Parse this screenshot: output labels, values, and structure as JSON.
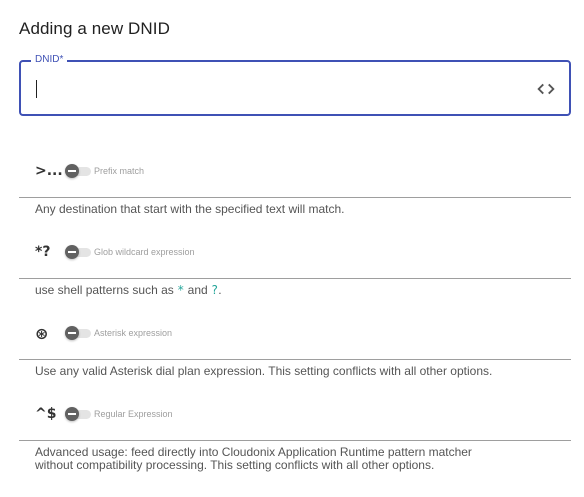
{
  "dialog": {
    "title": "Adding a new DNID"
  },
  "dnid_field": {
    "label": "DNID*",
    "value": ""
  },
  "options": [
    {
      "icon_text": ">...",
      "label": "Prefix match",
      "enabled": false,
      "description": "Any destination that start with the specified text will match."
    },
    {
      "icon_text": "*?",
      "label": "Glob wildcard expression",
      "enabled": false,
      "description_parts": {
        "before": "use shell patterns such as ",
        "code1": "*",
        "between": " and ",
        "code2": "?",
        "after": "."
      }
    },
    {
      "icon_text": "⊛",
      "label": "Asterisk expression",
      "enabled": false,
      "description": "Use any valid Asterisk dial plan expression. This setting conflicts with all other options."
    },
    {
      "icon_text": "^$",
      "label": "Regular Expression",
      "enabled": false,
      "description_lines": [
        "Advanced usage: feed directly into Cloudonix Application Runtime pattern matcher",
        "without compatibility processing. This setting conflicts with all other options."
      ]
    }
  ],
  "colors": {
    "accent": "#3f51b5",
    "code": "#26a69a",
    "divider": "#9e9e9e"
  }
}
